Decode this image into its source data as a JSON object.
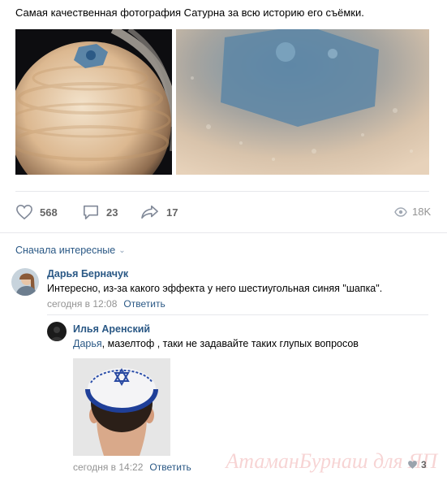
{
  "post": {
    "text": "Самая качественная фотография Сатурна за всю историю его съёмки."
  },
  "actions": {
    "likes": "568",
    "comments": "23",
    "shares": "17",
    "views": "18K"
  },
  "comments_sort": "Сначала интересные",
  "comments": [
    {
      "author": "Дарья Берначук",
      "text": "Интересно, из-за какого эффекта у него шестиугольная синяя \"шапка\".",
      "time": "сегодня в 12:08",
      "reply_label": "Ответить"
    }
  ],
  "reply": {
    "author": "Илья Аренский",
    "mention": "Дарья",
    "text": ", мазелтоф , таки не задавайте таких глупых вопросов",
    "time": "сегодня в 14:22",
    "reply_label": "Ответить",
    "likes": "3"
  },
  "watermark": "АтаманБурнаш для ЯП",
  "colors": {
    "link": "#2a5885",
    "secondary": "#939393",
    "divider": "#e7e8ec"
  }
}
